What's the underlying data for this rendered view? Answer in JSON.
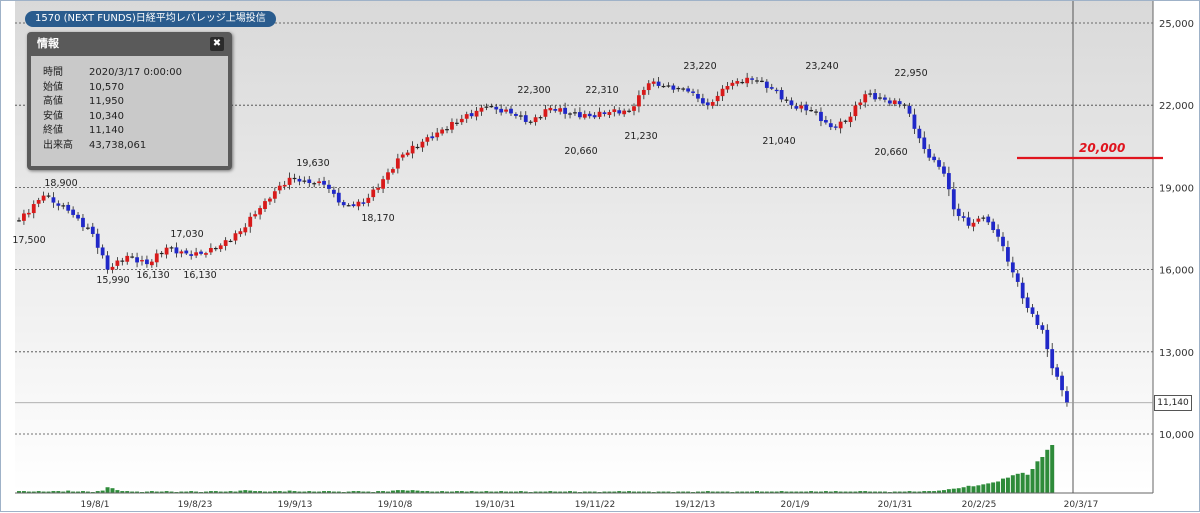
{
  "title": "1570 (NEXT FUNDS)日経平均レバレッジ上場投信",
  "info_panel": {
    "header": "情報",
    "close_icon": "close-icon",
    "rows": [
      {
        "key": "時間",
        "value": "2020/3/17 0:00:00"
      },
      {
        "key": "始値",
        "value": "10,570"
      },
      {
        "key": "高値",
        "value": "11,950"
      },
      {
        "key": "安値",
        "value": "10,340"
      },
      {
        "key": "終値",
        "value": "11,140"
      },
      {
        "key": "出来高",
        "value": "43,738,061"
      }
    ]
  },
  "price_tag": "11,140",
  "annotation": {
    "label": "20,000",
    "value": 20000,
    "color": "#e0141e"
  },
  "colors": {
    "up": "#d81a1a",
    "down": "#2028c8",
    "doji": "#222222",
    "volume": "#2e8b3a"
  },
  "chart_data": {
    "type": "candlestick",
    "y_axis": {
      "ticks": [
        10000,
        13000,
        16000,
        19000,
        22000,
        25000
      ],
      "tick_labels": [
        "10,000",
        "13,000",
        "16,000",
        "19,000",
        "22,000",
        "25,000"
      ],
      "position": "right"
    },
    "x_axis": {
      "tick_labels": [
        "19/8/1",
        "19/8/23",
        "19/9/13",
        "19/10/8",
        "19/10/31",
        "19/11/22",
        "19/12/13",
        "20/1/9",
        "20/1/31",
        "20/2/25",
        "20/3/17"
      ]
    },
    "price_labels": [
      {
        "text": "17,500",
        "value": 17500
      },
      {
        "text": "18,900",
        "value": 18900
      },
      {
        "text": "15,990",
        "value": 15990
      },
      {
        "text": "16,130",
        "value": 16130
      },
      {
        "text": "17,030",
        "value": 17030
      },
      {
        "text": "16,130",
        "value": 16130
      },
      {
        "text": "19,630",
        "value": 19630
      },
      {
        "text": "18,170",
        "value": 18170
      },
      {
        "text": "22,300",
        "value": 22300
      },
      {
        "text": "20,660",
        "value": 20660
      },
      {
        "text": "22,310",
        "value": 22310
      },
      {
        "text": "21,230",
        "value": 21230
      },
      {
        "text": "23,220",
        "value": 23220
      },
      {
        "text": "21,040",
        "value": 21040
      },
      {
        "text": "23,240",
        "value": 23240
      },
      {
        "text": "22,950",
        "value": 22950
      },
      {
        "text": "20,660",
        "value": 20660
      }
    ],
    "anchors": [
      [
        0,
        17800,
        1
      ],
      [
        5,
        18700,
        0
      ],
      [
        10,
        18150,
        1
      ],
      [
        15,
        17300,
        1
      ],
      [
        18,
        16000,
        1
      ],
      [
        22,
        16500,
        0
      ],
      [
        26,
        16200,
        1
      ],
      [
        30,
        16800,
        0
      ],
      [
        35,
        16500,
        1
      ],
      [
        40,
        16750,
        0
      ],
      [
        45,
        17400,
        0
      ],
      [
        50,
        18500,
        0
      ],
      [
        55,
        19350,
        0
      ],
      [
        58,
        19250,
        1
      ],
      [
        62,
        19100,
        1
      ],
      [
        66,
        18350,
        1
      ],
      [
        70,
        18400,
        0
      ],
      [
        74,
        19300,
        0
      ],
      [
        78,
        20200,
        0
      ],
      [
        85,
        21000,
        0
      ],
      [
        90,
        21500,
        0
      ],
      [
        95,
        21950,
        0
      ],
      [
        100,
        21700,
        1
      ],
      [
        104,
        21400,
        1
      ],
      [
        108,
        21900,
        0
      ],
      [
        112,
        21700,
        1
      ],
      [
        116,
        21600,
        0
      ],
      [
        120,
        21750,
        0
      ],
      [
        124,
        21800,
        0
      ],
      [
        128,
        22800,
        0
      ],
      [
        132,
        22700,
        1
      ],
      [
        136,
        22500,
        1
      ],
      [
        140,
        22000,
        1
      ],
      [
        144,
        22700,
        0
      ],
      [
        148,
        23000,
        0
      ],
      [
        150,
        22900,
        1
      ],
      [
        153,
        22600,
        1
      ],
      [
        157,
        22000,
        1
      ],
      [
        161,
        21800,
        1
      ],
      [
        165,
        21200,
        1
      ],
      [
        168,
        21400,
        0
      ],
      [
        172,
        22400,
        0
      ],
      [
        176,
        22200,
        1
      ],
      [
        180,
        22000,
        1
      ],
      [
        184,
        20400,
        1
      ],
      [
        188,
        19500,
        1
      ],
      [
        190,
        18200,
        1
      ],
      [
        193,
        17600,
        1
      ],
      [
        196,
        17900,
        0
      ],
      [
        199,
        17200,
        1
      ],
      [
        202,
        15900,
        1
      ],
      [
        205,
        14600,
        1
      ],
      [
        208,
        13800,
        1
      ],
      [
        210,
        12400,
        1
      ],
      [
        212,
        11600,
        1
      ],
      [
        213,
        11140,
        0
      ]
    ],
    "volume": [
      4,
      4,
      3,
      3,
      4,
      3,
      3,
      4,
      4,
      3,
      5,
      3,
      3,
      4,
      3,
      2,
      4,
      5,
      12,
      10,
      6,
      4,
      4,
      3,
      3,
      2,
      3,
      4,
      3,
      3,
      4,
      3,
      2,
      3,
      3,
      4,
      3,
      2,
      3,
      4,
      4,
      3,
      3,
      4,
      3,
      5,
      6,
      5,
      4,
      4,
      3,
      3,
      4,
      4,
      3,
      5,
      4,
      3,
      3,
      4,
      3,
      3,
      4,
      4,
      3,
      3,
      2,
      3,
      4,
      4,
      3,
      3,
      2,
      4,
      4,
      3,
      5,
      6,
      6,
      5,
      6,
      5,
      4,
      4,
      3,
      3,
      4,
      3,
      3,
      4,
      4,
      3,
      4,
      3,
      3,
      4,
      3,
      3,
      4,
      3,
      3,
      3,
      4,
      3,
      2,
      3,
      3,
      3,
      4,
      3,
      3,
      3,
      4,
      3,
      2,
      3,
      3,
      3,
      2,
      3,
      3,
      3,
      4,
      3,
      4,
      3,
      3,
      3,
      3,
      2,
      3,
      3,
      3,
      2,
      3,
      3,
      3,
      2,
      3,
      3,
      4,
      3,
      3,
      3,
      3,
      2,
      3,
      3,
      3,
      3,
      4,
      3,
      3,
      3,
      3,
      4,
      3,
      3,
      3,
      3,
      3,
      4,
      3,
      3,
      4,
      3,
      4,
      3,
      3,
      3,
      3,
      4,
      4,
      3,
      3,
      3,
      3,
      2,
      3,
      3,
      3,
      4,
      3,
      3,
      4,
      4,
      4,
      5,
      6,
      8,
      9,
      10,
      12,
      15,
      14,
      16,
      18,
      20,
      22,
      24,
      30,
      32,
      37,
      40,
      42,
      38,
      50,
      66,
      75,
      90,
      100
    ]
  }
}
